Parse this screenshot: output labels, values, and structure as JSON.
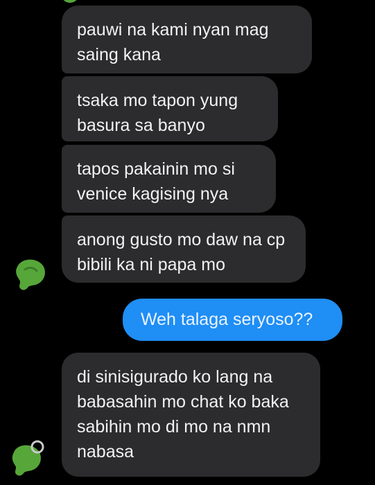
{
  "conversation": {
    "messages": [
      {
        "direction": "incoming",
        "text": "pauwi na kami nyan mag saing kana"
      },
      {
        "direction": "incoming",
        "text": "tsaka mo tapon yung basura sa banyo"
      },
      {
        "direction": "incoming",
        "text": "tapos pakainin mo si venice kagising nya"
      },
      {
        "direction": "incoming",
        "text": "anong gusto mo daw na cp bibili ka ni papa mo"
      },
      {
        "direction": "outgoing",
        "text": "Weh talaga seryoso??"
      },
      {
        "direction": "incoming",
        "text": "di sinisigurado ko lang na babasahin mo chat ko baka sabihin mo di mo na nmn nabasa"
      }
    ]
  },
  "colors": {
    "background": "#000000",
    "incoming_bubble": "#2c2c2e",
    "outgoing_bubble": "#1f8ef5",
    "incoming_text": "#f2f2f2",
    "avatar": "#57a63a"
  },
  "icons": {
    "sender_avatar": "green-leaf-avatar-icon"
  }
}
